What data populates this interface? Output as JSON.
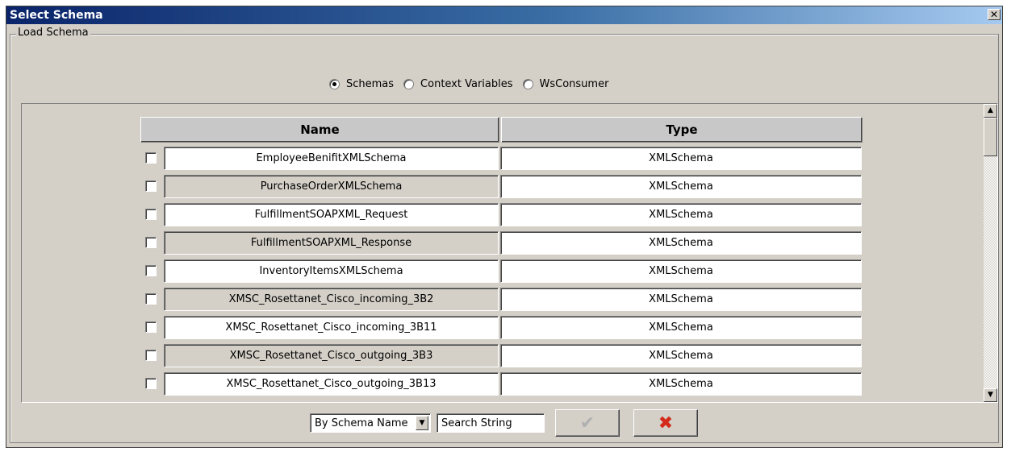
{
  "window": {
    "title": "Select Schema",
    "close_symbol": "✕"
  },
  "group": {
    "label": "Load Schema"
  },
  "source_options": [
    {
      "label": "Schemas",
      "checked": true
    },
    {
      "label": "Context Variables",
      "checked": false
    },
    {
      "label": "WsConsumer",
      "checked": false
    }
  ],
  "table": {
    "columns": {
      "name": "Name",
      "type": "Type"
    },
    "rows": [
      {
        "name": "EmployeeBenifitXMLSchema",
        "type": "XMLSchema",
        "checked": false
      },
      {
        "name": "PurchaseOrderXMLSchema",
        "type": "XMLSchema",
        "checked": false
      },
      {
        "name": "FulfillmentSOAPXML_Request",
        "type": "XMLSchema",
        "checked": false
      },
      {
        "name": "FulfillmentSOAPXML_Response",
        "type": "XMLSchema",
        "checked": false
      },
      {
        "name": "InventoryItemsXMLSchema",
        "type": "XMLSchema",
        "checked": false
      },
      {
        "name": "XMSC_Rosettanet_Cisco_incoming_3B2",
        "type": "XMLSchema",
        "checked": false
      },
      {
        "name": "XMSC_Rosettanet_Cisco_incoming_3B11",
        "type": "XMLSchema",
        "checked": false
      },
      {
        "name": "XMSC_Rosettanet_Cisco_outgoing_3B3",
        "type": "XMLSchema",
        "checked": false
      },
      {
        "name": "XMSC_Rosettanet_Cisco_outgoing_3B13",
        "type": "XMLSchema",
        "checked": false
      }
    ]
  },
  "filter": {
    "selected": "By Schema Name",
    "search_value": "Search String"
  },
  "icons": {
    "confirm": "check-icon",
    "cancel": "x-icon",
    "scroll_up": "arrow-up-icon",
    "scroll_down": "arrow-down-icon",
    "combo_arrow": "chevron-down-icon"
  },
  "colors": {
    "title_start": "#0a246a",
    "title_end": "#a6caf0",
    "dialog_bg": "#d4d0c8",
    "cancel_icon": "#d42a1a",
    "confirm_icon_disabled": "#b0b0b0"
  }
}
